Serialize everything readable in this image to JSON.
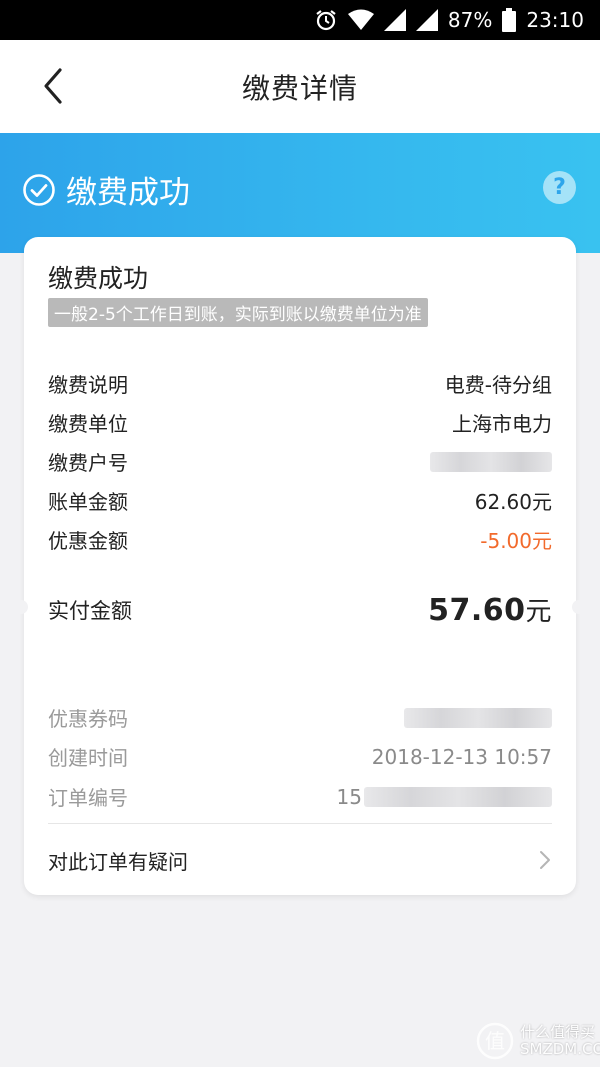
{
  "status_bar": {
    "battery": "87%",
    "time": "23:10"
  },
  "nav": {
    "title": "缴费详情"
  },
  "banner": {
    "status": "缴费成功"
  },
  "card": {
    "heading": "缴费成功",
    "subtext": "一般2-5个工作日到账，实际到账以缴费单位为准",
    "rows": [
      {
        "label": "缴费说明",
        "value": "电费-待分组"
      },
      {
        "label": "缴费单位",
        "value": "上海市电力"
      },
      {
        "label": "缴费户号",
        "value": ""
      },
      {
        "label": "账单金额",
        "value": "62.60元"
      },
      {
        "label": "优惠金额",
        "value": "-5.00元"
      }
    ],
    "paid": {
      "label": "实付金额",
      "amount": "57.60",
      "unit": "元"
    },
    "meta_rows": [
      {
        "label": "优惠券码",
        "value": ""
      },
      {
        "label": "创建时间",
        "value": "2018-12-13 10:57"
      },
      {
        "label": "订单编号",
        "value": "15"
      }
    ],
    "question": "对此订单有疑问"
  },
  "watermark": {
    "line1": "什么值得买",
    "line2": "SMZDM.COM"
  },
  "colors": {
    "accent_blue": "#2da3ea",
    "discount_orange": "#f26a2c"
  }
}
